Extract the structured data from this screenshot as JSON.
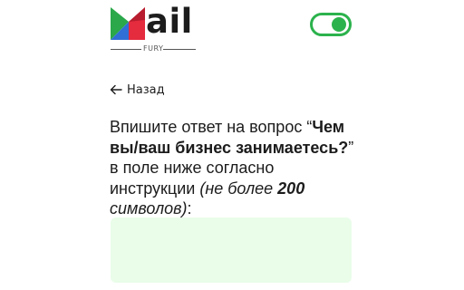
{
  "logo": {
    "word": "ail",
    "sub": "FURY"
  },
  "toggle": {
    "state": "on",
    "color": "#2bb24c"
  },
  "back": {
    "label": "Назад",
    "icon": "arrow-left-icon"
  },
  "instruction": {
    "part1": "Впишите ответ на вопрос “",
    "question": "Чем вы/ваш бизнес занимаетесь?",
    "part2": "” в поле ниже согласно инструкции ",
    "limit_prefix": "(не более ",
    "limit_number": "200",
    "limit_suffix": " символов)",
    "part3": ":"
  },
  "answer": {
    "value": "",
    "background": "#e9fde9"
  }
}
